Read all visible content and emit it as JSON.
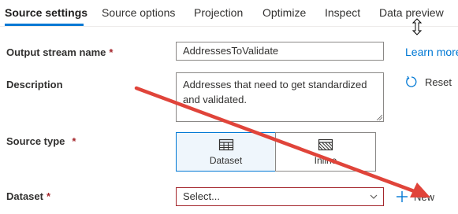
{
  "tabs": [
    {
      "label": "Source settings",
      "active": true
    },
    {
      "label": "Source options"
    },
    {
      "label": "Projection"
    },
    {
      "label": "Optimize"
    },
    {
      "label": "Inspect"
    },
    {
      "label": "Data preview"
    }
  ],
  "form": {
    "output_stream": {
      "label": "Output stream name",
      "required_marker": "*",
      "value": "AddressesToValidate"
    },
    "description": {
      "label": "Description",
      "value": "Addresses that need to get standardized and validated."
    },
    "source_type": {
      "label": "Source type",
      "required_marker": "*",
      "options": [
        {
          "label": "Dataset",
          "icon": "table-grid-icon",
          "selected": true
        },
        {
          "label": "Inline",
          "icon": "hatched-grid-icon",
          "selected": false
        }
      ]
    },
    "dataset": {
      "label": "Dataset",
      "required_marker": "*",
      "placeholder": "Select...",
      "new_label": "New"
    }
  },
  "actions": {
    "learn_more": "Learn more",
    "reset": "Reset"
  },
  "annotation": {
    "type": "arrow",
    "color": "#e0443a"
  },
  "colors": {
    "accent": "#0078d4",
    "error": "#a4262c",
    "selected_bg": "#eff6fc"
  }
}
